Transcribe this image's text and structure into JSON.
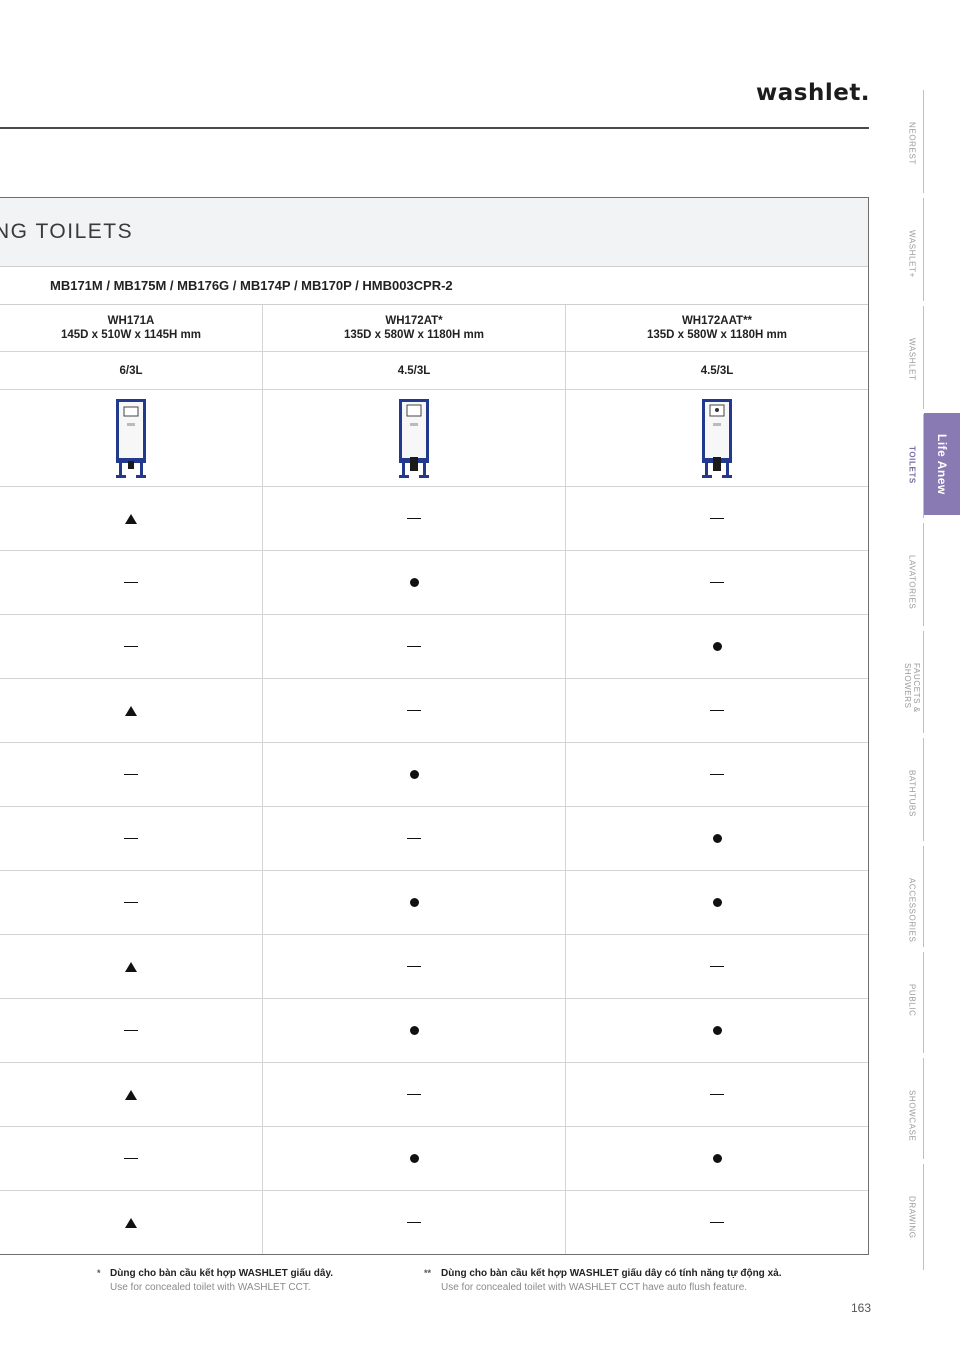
{
  "brand": {
    "logo": "washlet."
  },
  "section": {
    "title": "NG TOILETS",
    "series": "MB171M / MB175M / MB176G / MB174P / MB170P / HMB003CPR-2"
  },
  "columns": [
    {
      "model": "WH171A",
      "dims": "145D x 510W x 1145H mm",
      "flush": "6/3L",
      "image": "in-wall-tank-frame"
    },
    {
      "model": "WH172AT*",
      "dims": "135D x 580W x 1180H mm",
      "flush": "4.5/3L",
      "image": "in-wall-tank-frame"
    },
    {
      "model": "WH172AAT**",
      "dims": "135D x 580W x 1180H mm",
      "flush": "4.5/3L",
      "image": "in-wall-tank-frame"
    }
  ],
  "features": [
    [
      "triangle",
      "dash",
      "dash"
    ],
    [
      "dash",
      "dot",
      "dash"
    ],
    [
      "dash",
      "dash",
      "dot"
    ],
    [
      "triangle",
      "dash",
      "dash"
    ],
    [
      "dash",
      "dot",
      "dash"
    ],
    [
      "dash",
      "dash",
      "dot"
    ],
    [
      "dash",
      "dot",
      "dot"
    ],
    [
      "triangle",
      "dash",
      "dash"
    ],
    [
      "dash",
      "dot",
      "dot"
    ],
    [
      "triangle",
      "dash",
      "dash"
    ],
    [
      "dash",
      "dot",
      "dot"
    ],
    [
      "triangle",
      "dash",
      "dash"
    ]
  ],
  "notes": [
    {
      "mark": "*",
      "vi": "Dùng cho bàn cầu kết hợp WASHLET giấu dây.",
      "en": "Use for concealed toilet with WASHLET CCT."
    },
    {
      "mark": "**",
      "vi": "Dùng cho bàn cầu kết hợp WASHLET giấu dây có tính năng tự động xả.",
      "en": "Use for concealed toilet with WASHLET CCT have auto flush feature."
    }
  ],
  "page_number": "163",
  "side_nav": {
    "items": [
      "NEOREST",
      "WASHLET+",
      "WASHLET",
      "TOILETS",
      "LAVATORIES",
      "FAUCETS & SHOWERS",
      "BATHTUBS",
      "ACCESSORIES",
      "PUBLIC",
      "SHOWCASE",
      "DRAWING"
    ],
    "active": "TOILETS",
    "tab_label": "Life Anew",
    "accent_color": "#8a7ab3"
  }
}
